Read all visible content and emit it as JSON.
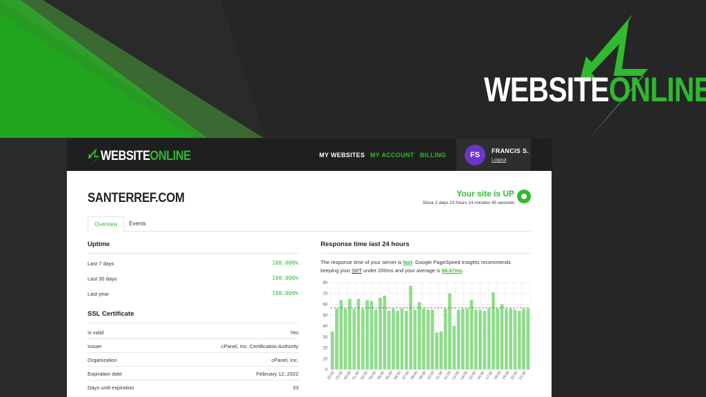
{
  "brand": {
    "part1": "WEBSITE",
    "part2": "ONLINE",
    "green": "#2fba2f"
  },
  "nav": {
    "items": [
      {
        "label": "MY WEBSITES"
      },
      {
        "label": "MY ACCOUNT"
      },
      {
        "label": "BILLING"
      }
    ]
  },
  "user": {
    "initials": "FS",
    "name": "FRANCIS S.",
    "logout": "Logout",
    "avatar_color": "#6a36c9"
  },
  "site": {
    "title": "SANTERREF.COM",
    "status_title": "Your site is UP",
    "status_sub": "Since 2 days 23 hours 14 minutes 45 seconds"
  },
  "tabs": [
    {
      "label": "Overview"
    },
    {
      "label": "Events"
    }
  ],
  "uptime": {
    "heading": "Uptime",
    "rows": [
      {
        "label": "Last 7 days",
        "value": "100.000%"
      },
      {
        "label": "Last 30 days",
        "value": "100.000%"
      },
      {
        "label": "Last year",
        "value": "100.000%"
      }
    ]
  },
  "ssl": {
    "heading": "SSL Certificate",
    "rows": [
      {
        "label": "Is valid",
        "value": "Yes"
      },
      {
        "label": "Issuer",
        "value": "cPanel, Inc. Certification Authority"
      },
      {
        "label": "Organization",
        "value": "cPanel, Inc."
      },
      {
        "label": "Expiration date",
        "value": "February 12, 2022"
      },
      {
        "label": "Days until expiration",
        "value": "33"
      }
    ]
  },
  "response": {
    "heading": "Response time last 24 hours",
    "t1": "The response time of your server is ",
    "fast": "fast",
    "t2": ". Google PageSpeed Insights recommends keeping your ",
    "srt": "SRT",
    "t3": " under 200ms and your average is ",
    "avg": "56.67ms",
    "t4": "."
  },
  "chart_data": {
    "type": "bar",
    "ylim": [
      0,
      80
    ],
    "yticks": [
      0,
      10,
      20,
      30,
      40,
      50,
      60,
      70,
      80
    ],
    "average": 56.67,
    "bar_color": "#8fdc8c",
    "categories": [
      "22:00",
      "23:00",
      "00:00",
      "00:00",
      "01:00",
      "01:00",
      "02:00",
      "02:00",
      "03:00",
      "03:00",
      "04:00",
      "04:00",
      "05:00",
      "05:00",
      "06:00",
      "06:00",
      "07:00",
      "07:00",
      "08:00",
      "08:00",
      "09:00",
      "09:00",
      "10:00",
      "10:00",
      "11:00",
      "11:00",
      "12:00",
      "12:00",
      "13:00",
      "13:00",
      "14:00",
      "14:00",
      "15:00",
      "15:00",
      "16:00",
      "16:00",
      "17:00",
      "17:00",
      "18:00",
      "18:00",
      "19:00",
      "19:00",
      "20:00",
      "20:00",
      "21:00",
      "21:00"
    ],
    "values": [
      35,
      56,
      64,
      56,
      65,
      56,
      65,
      56,
      64,
      63,
      55,
      66,
      68,
      54,
      56,
      54,
      56,
      54,
      77,
      55,
      62,
      56,
      55,
      55,
      34,
      35,
      56,
      70,
      40,
      55,
      56,
      56,
      64,
      55,
      55,
      54,
      56,
      71,
      56,
      60,
      56,
      56,
      55,
      54,
      56,
      56
    ],
    "xlabels": [
      "22:00",
      "23:00",
      "00:00",
      "01:00",
      "02:00",
      "03:00",
      "04:00",
      "05:00",
      "06:00",
      "07:00",
      "08:00",
      "09:00",
      "10:00",
      "11:00",
      "12:00",
      "13:00",
      "14:00",
      "15:00",
      "16:00",
      "17:00",
      "18:00",
      "19:00",
      "20:00",
      "21:00"
    ]
  }
}
